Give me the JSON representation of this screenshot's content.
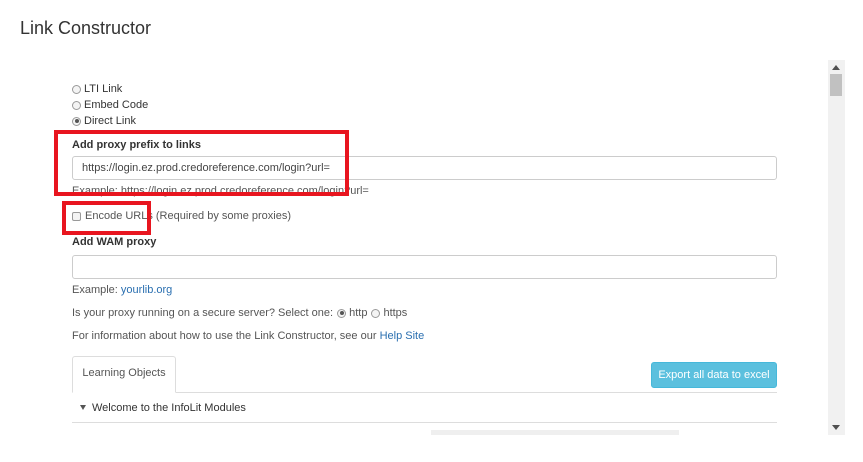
{
  "page": {
    "title": "Link Constructor"
  },
  "link_type": {
    "options": [
      {
        "label": "LTI Link",
        "checked": false
      },
      {
        "label": "Embed Code",
        "checked": false
      },
      {
        "label": "Direct Link",
        "checked": true
      }
    ]
  },
  "proxy_prefix": {
    "label": "Add proxy prefix to links",
    "value": "https://login.ez.prod.credoreference.com/login?url=",
    "example": "Example: https://login.ez.prod.credoreference.com/login?url="
  },
  "encode_urls": {
    "label": "Encode URLs",
    "note": "(Required by some proxies)",
    "checked": false
  },
  "wam_proxy": {
    "label": "Add WAM proxy",
    "value": "",
    "example_prefix": "Example:",
    "example_link": "yourlib.org"
  },
  "secure_server": {
    "question": "Is your proxy running on a secure server? Select one:",
    "options": [
      {
        "label": "http",
        "checked": true
      },
      {
        "label": "https",
        "checked": false
      }
    ]
  },
  "info": {
    "text": "For information about how to use the Link Constructor, see our",
    "link": "Help Site"
  },
  "tabs": [
    {
      "label": "Learning Objects",
      "active": true
    }
  ],
  "export_button": {
    "label": "Export all data to excel"
  },
  "tree": {
    "items": [
      {
        "label": "Welcome to the InfoLit Modules",
        "expanded": true
      }
    ]
  },
  "colors": {
    "highlight": "#e8151f",
    "accent_button": "#5bc0de",
    "link": "#2a6fb0"
  }
}
